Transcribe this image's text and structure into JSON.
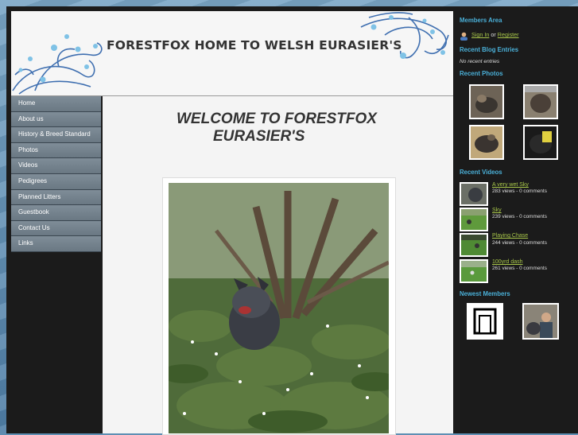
{
  "site": {
    "title": "FORESTFOX HOME TO WELSH EURASIER'S"
  },
  "nav": {
    "items": [
      {
        "label": "Home"
      },
      {
        "label": "About us"
      },
      {
        "label": "History & Breed Standard"
      },
      {
        "label": "Photos"
      },
      {
        "label": "Videos"
      },
      {
        "label": "Pedigrees"
      },
      {
        "label": "Planned Litters"
      },
      {
        "label": "Guestbook"
      },
      {
        "label": "Contact Us"
      },
      {
        "label": "Links"
      }
    ]
  },
  "main": {
    "welcome_line1": "WELCOME TO FORESTFOX",
    "welcome_line2": "EURASIER'S"
  },
  "sidebar": {
    "members_area": {
      "heading": "Members Area",
      "sign_in": "Sign In",
      "or": "or",
      "register": "Register"
    },
    "blog": {
      "heading": "Recent Blog Entries",
      "empty": "No recent entries"
    },
    "photos": {
      "heading": "Recent Photos"
    },
    "videos": {
      "heading": "Recent Videos",
      "items": [
        {
          "title": "A very wet Sky",
          "meta": "283 views - 0 comments"
        },
        {
          "title": "Sky",
          "meta": "239 views - 0 comments"
        },
        {
          "title": "Playing Chase",
          "meta": "244 views - 0 comments"
        },
        {
          "title": "100yrd dash",
          "meta": "261 views - 0 comments"
        }
      ]
    },
    "members": {
      "heading": "Newest Members"
    }
  },
  "colors": {
    "accent_heading": "#4ab0d8",
    "link": "#a8c64a",
    "nav_bg": "#74828d",
    "frame_bg": "#1b1b1b"
  }
}
